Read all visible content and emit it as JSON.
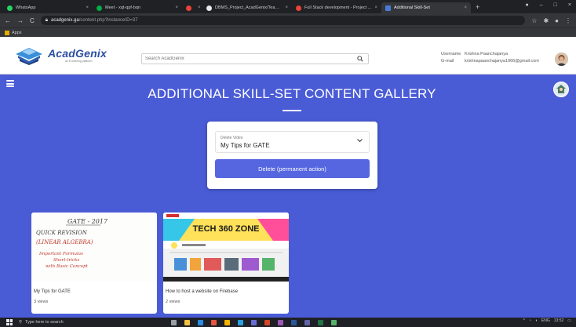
{
  "browser": {
    "tabs": [
      {
        "title": "WhatsApp",
        "favicon_color": "#25d366",
        "active": false
      },
      {
        "title": "Meet - xqt-qpf-bqn",
        "favicon_color": "#00ac47",
        "active": false
      },
      {
        "title": "",
        "favicon_color": "#ea4335",
        "active": false
      },
      {
        "title": "DBMS_Project_AcadGenix/Team: ...",
        "favicon_color": "#e8eaed",
        "active": false
      },
      {
        "title": "Full Stack development - Project ...",
        "favicon_color": "#ea4335",
        "active": false
      },
      {
        "title": "Additional Skill-Set",
        "favicon_color": "#4a7bd6",
        "active": true
      }
    ],
    "url_host": "acadgenix.ga",
    "url_path": "/content.php?instanceID=37",
    "bookmark_apps": "Apps"
  },
  "site": {
    "logo_name": "AcadGenix",
    "logo_tagline": "an E-learning platform",
    "search_placeholder": "Search AcadGenix",
    "user": {
      "username_label": "Username",
      "username": "Krishna Paanchajanya",
      "email_label": "G-mail",
      "email": "krishnapaanchajanya1966@gmail.com"
    }
  },
  "main": {
    "title": "ADDITIONAL SKILL-SET CONTENT GALLERY",
    "delete_form": {
      "select_label": "Delete Video",
      "selected_value": "My Tips for GATE",
      "button_label": "Delete (permanent action)"
    },
    "videos": [
      {
        "title": "My Tips for GATE",
        "views": "3 views",
        "thumb_lines": [
          "GATE - 2017",
          "QUICK REVISION",
          "(LINEAR ALGEBRA)",
          "Important Formulas",
          "Short-tricks",
          "with Basic Concept"
        ]
      },
      {
        "title": "How to host a website on Firebase",
        "views": "2 views",
        "thumb_banner": "TECH 360 ZONE"
      }
    ]
  },
  "taskbar": {
    "search_placeholder": "Type here to search",
    "language": "ENG",
    "time": "13:52"
  },
  "colors": {
    "page_bg": "#4a5bd6",
    "button": "#5566e0",
    "logo": "#2c4fa0"
  }
}
